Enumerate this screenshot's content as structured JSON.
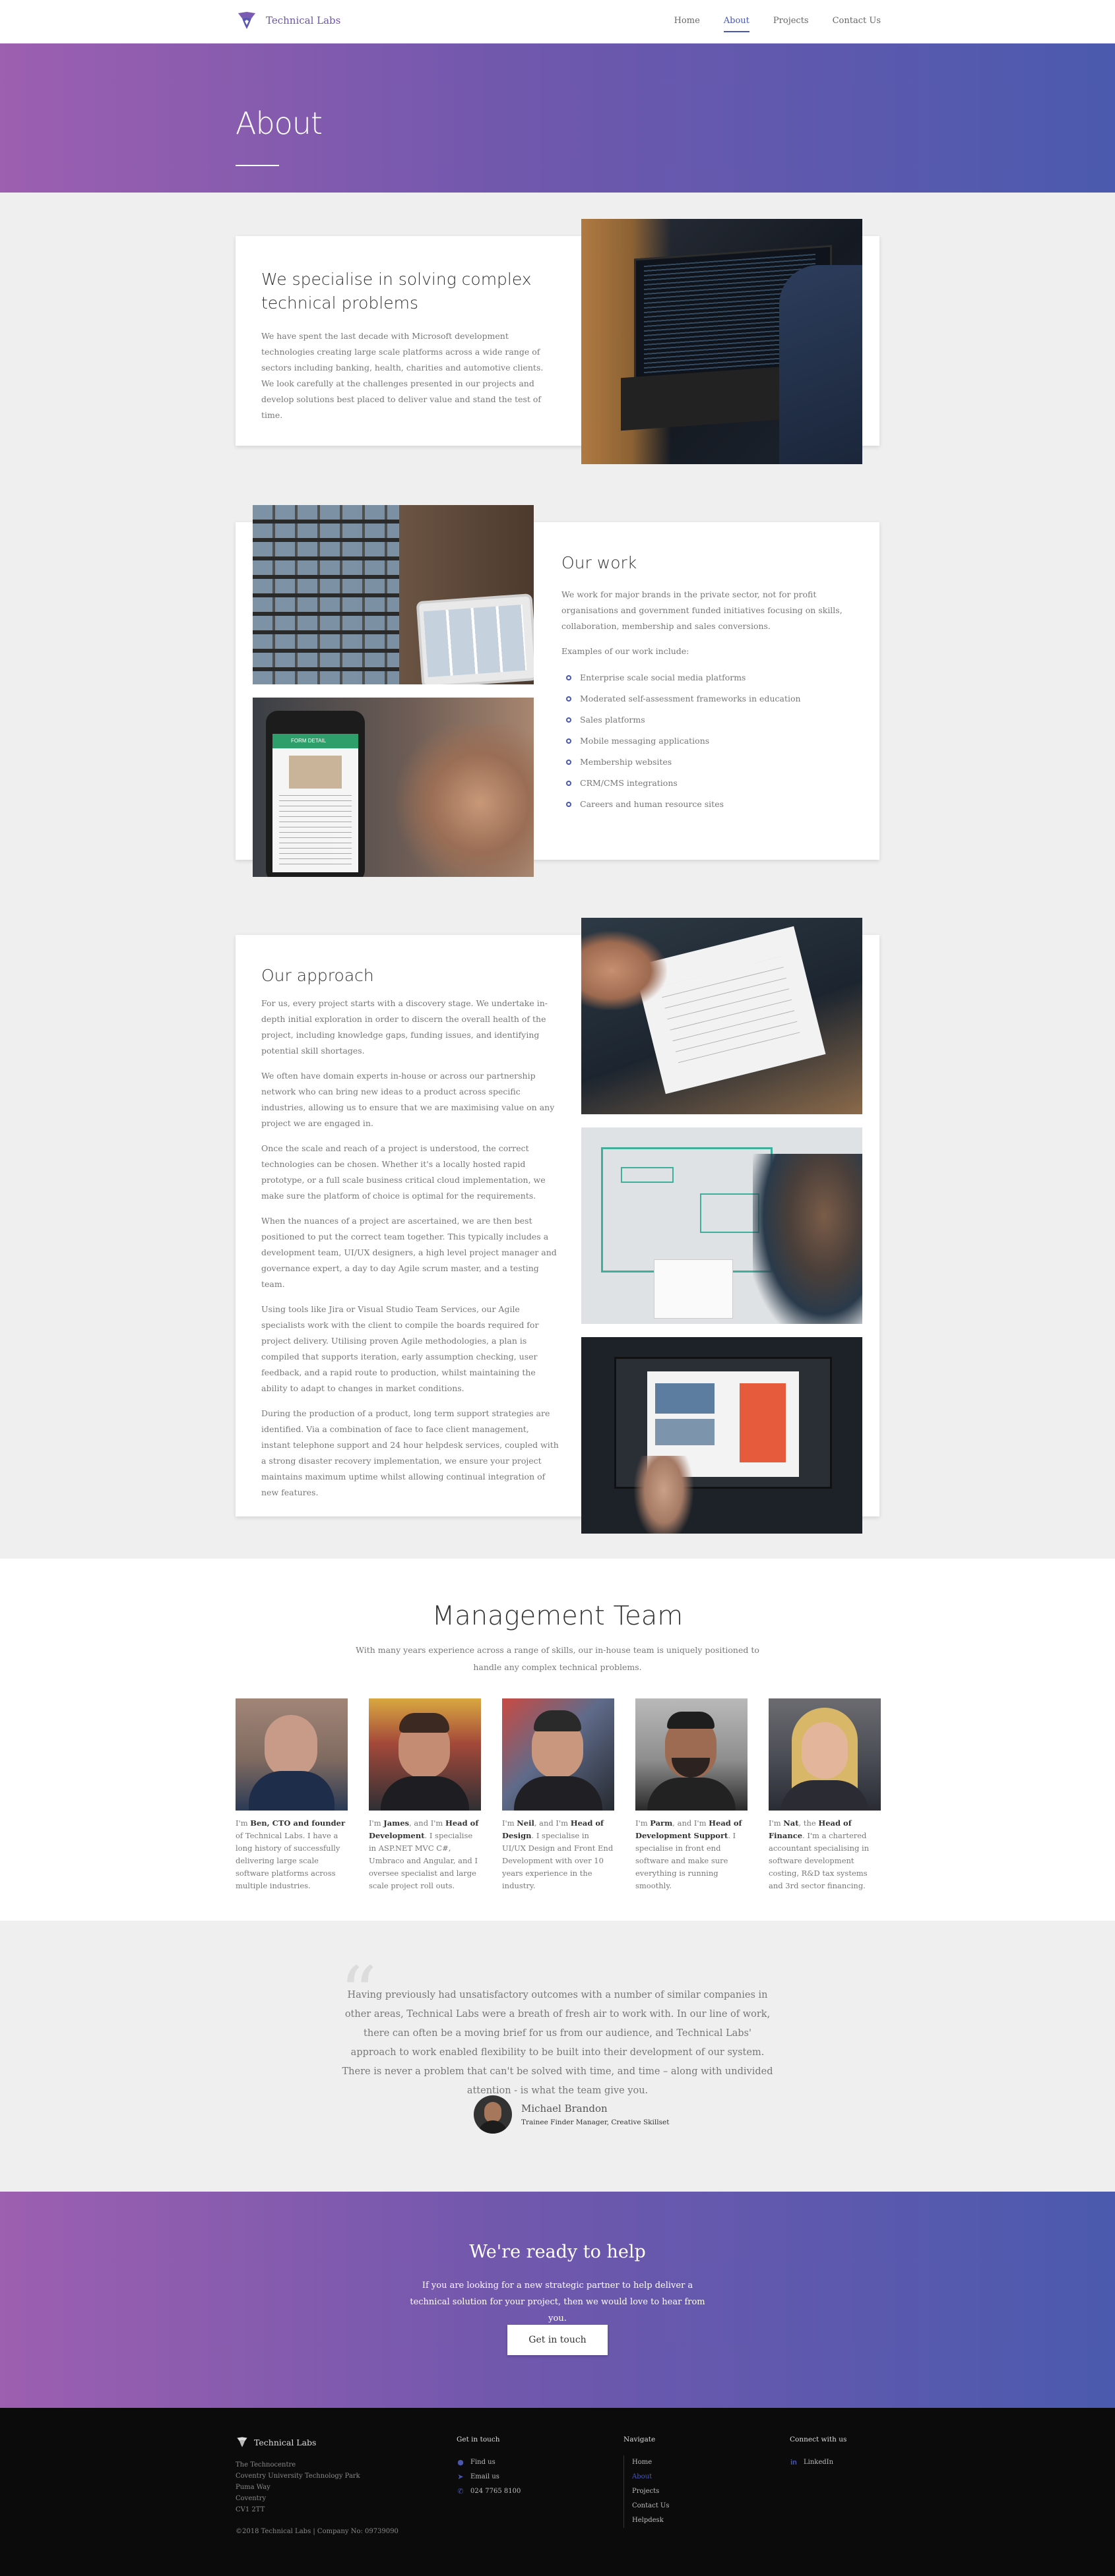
{
  "brand": {
    "name": "Technical Labs",
    "accent": "#4a57b0",
    "gradient_start": "#9d5fb0",
    "gradient_end": "#4b5aae"
  },
  "nav": {
    "items": [
      "Home",
      "About",
      "Projects",
      "Contact Us"
    ],
    "active": "About"
  },
  "hero": {
    "title": "About"
  },
  "specialise": {
    "title": "We specialise in solving complex technical problems",
    "body": "We have spent the last decade with Microsoft development technologies creating large scale platforms across a wide range of sectors including banking, health, charities and automotive clients. We look carefully at the challenges presented in our projects and develop solutions best placed to deliver value and stand the test of time."
  },
  "work": {
    "title": "Our work",
    "body": "We work for major brands in the private sector, not for profit organisations and government funded initiatives focusing on skills, collaboration, membership and sales conversions.",
    "examples_label": "Examples of our work include:",
    "items": [
      "Enterprise scale social media platforms",
      "Moderated self-assessment frameworks in education",
      "Sales platforms",
      "Mobile messaging applications",
      "Membership websites",
      "CRM/CMS integrations",
      "Careers and human resource sites"
    ],
    "phone_screen_header": "FORM DETAIL"
  },
  "approach": {
    "title": "Our approach",
    "paragraphs": [
      "For us, every project starts with a discovery stage. We undertake in-depth initial exploration in order to discern the overall health of the project, including knowledge gaps, funding issues, and identifying potential skill shortages.",
      "We often have domain experts in-house or across our partnership network who can bring new ideas to a product across specific industries, allowing us to ensure that we are maximising value on any project we are engaged in.",
      "Once the scale and reach of a project is understood, the correct technologies can be chosen. Whether it's a locally hosted rapid prototype, or a full scale business critical cloud implementation, we make sure the platform of choice is optimal for the requirements.",
      "When the nuances of a project are ascertained, we are then best positioned to put the correct team together. This typically includes a development team, UI/UX designers, a high level project manager and governance expert, a day to day Agile scrum master, and a testing team.",
      "Using tools like Jira or Visual Studio Team Services, our Agile specialists work with the client to compile the boards required for project delivery. Utilising proven Agile methodologies, a plan is compiled that supports iteration, early assumption checking, user feedback, and a rapid route to production, whilst maintaining the ability to adapt to changes in market conditions.",
      "During the production of a product, long term support strategies are identified. Via a combination of face to face client management, instant telephone support and 24 hour helpdesk services, coupled with a strong disaster recovery implementation, we ensure your project maintains maximum uptime whilst allowing continual integration of new features."
    ]
  },
  "team": {
    "title": "Management Team",
    "subtitle": "With many years experience across a range of skills, our in-house team is uniquely positioned to handle any complex technical problems.",
    "members": [
      {
        "pre": "I'm ",
        "name": "Ben, CTO and founder",
        "post": " of Technical Labs. I have a long history of successfully delivering large scale software platforms across multiple industries."
      },
      {
        "pre": "I'm ",
        "name": "James",
        "mid": ", and I'm ",
        "role": "Head of Development",
        "post": ". I specialise in ASP.NET MVC C#, Umbraco and Angular, and I oversee specialist and large scale project roll outs."
      },
      {
        "pre": "I'm ",
        "name": "Neil",
        "mid": ", and I'm ",
        "role": "Head of Design",
        "post": ". I specialise in UI/UX Design and Front End Development with over 10 years experience in the industry."
      },
      {
        "pre": "I'm ",
        "name": "Parm",
        "mid": ", and I'm ",
        "role": "Head of Development Support",
        "post": ". I specialise in front end software and make sure everything is running smoothly."
      },
      {
        "pre": "I'm ",
        "name": "Nat",
        "mid": ", the ",
        "role": "Head of Finance",
        "post": ". I'm a chartered accountant specialising in software development costing, R&D tax systems and 3rd sector financing."
      }
    ]
  },
  "testimonial": {
    "quote": "Having previously had unsatisfactory outcomes with a number of similar companies in other areas, Technical Labs were a breath of fresh air to work with. In our line of work, there can often be a moving brief for us from our audience, and Technical Labs' approach to work enabled flexibility to be built into their development of our system. There is never a problem that can't be solved with time, and time – along with undivided attention - is what the team give you.",
    "author": "Michael Brandon",
    "role": "Trainee Finder Manager, Creative Skillset"
  },
  "cta": {
    "title": "We're ready to help",
    "body": "If you are looking for a new strategic partner to help deliver a technical solution for your project, then we would love to hear from you.",
    "button": "Get in touch"
  },
  "footer": {
    "brand": "Technical Labs",
    "address": [
      "The Technocentre",
      "Coventry University Technology Park",
      "Puma Way",
      "Coventry",
      "CV1 2TT"
    ],
    "copyright": "©2018 Technical Labs | Company No: 09739090",
    "get_in_touch": {
      "title": "Get in touch",
      "find_us": "Find us",
      "email_us": "Email us",
      "phone": "024 7765 8100"
    },
    "navigate": {
      "title": "Navigate",
      "items": [
        "Home",
        "About",
        "Projects",
        "Contact Us",
        "Helpdesk"
      ],
      "active": "About"
    },
    "connect": {
      "title": "Connect with us",
      "linkedin": "LinkedIn"
    }
  }
}
